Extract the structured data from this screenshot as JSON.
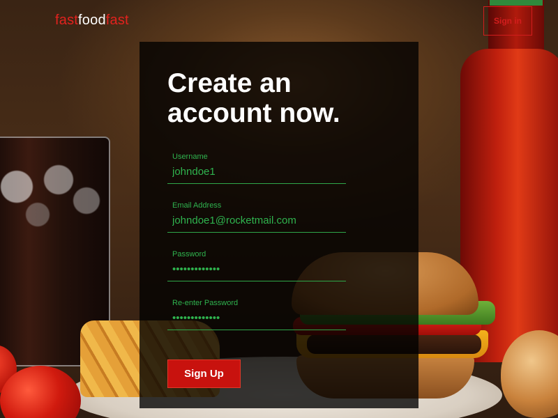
{
  "header": {
    "logo": {
      "part1": "fast",
      "part2": "food",
      "part3": "fast"
    },
    "signin_label": "Sign in"
  },
  "form": {
    "title_line1": "Create an",
    "title_line2": "account now.",
    "fields": [
      {
        "label": "Username",
        "value": "johndoe1",
        "type": "text"
      },
      {
        "label": "Email Address",
        "value": "johndoe1@rocketmail.com",
        "type": "email"
      },
      {
        "label": "Password",
        "value": "•••••••••••••",
        "type": "password"
      },
      {
        "label": "Re-enter Password",
        "value": "•••••••••••••",
        "type": "password"
      }
    ],
    "submit_label": "Sign Up"
  },
  "colors": {
    "brand_red": "#e2221e",
    "field_green": "#2fb34e",
    "button_red": "#c8120e"
  }
}
